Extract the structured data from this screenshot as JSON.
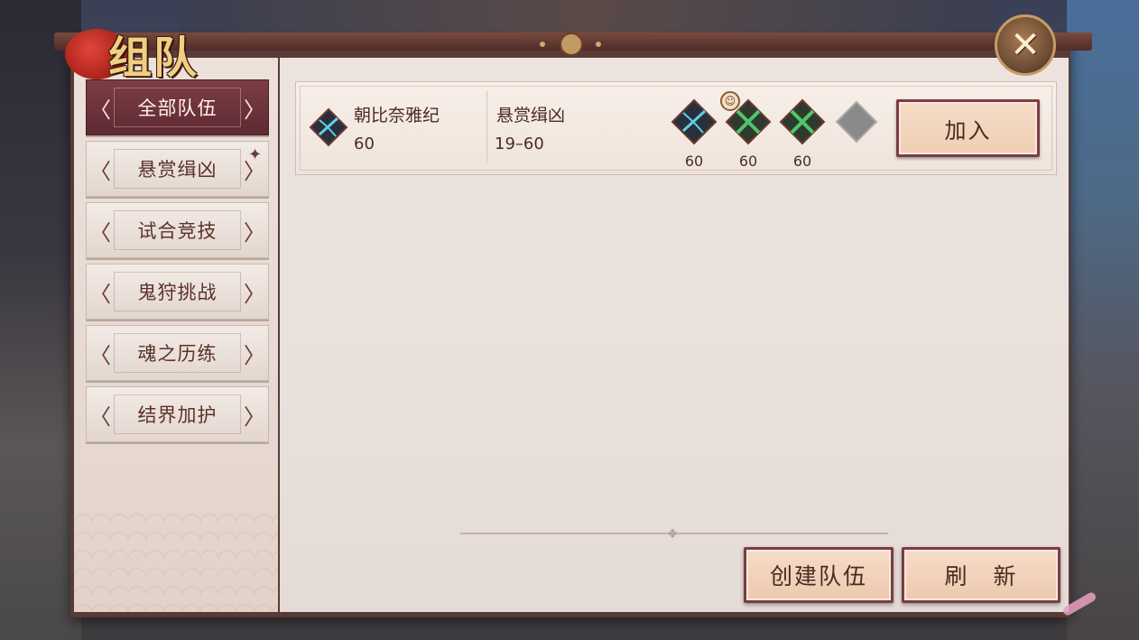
{
  "window": {
    "title": "组队",
    "close_label": "✕"
  },
  "sidebar": {
    "items": [
      {
        "label": "全部队伍",
        "active": true
      },
      {
        "label": "悬赏缉凶",
        "active": false
      },
      {
        "label": "试合竞技",
        "active": false
      },
      {
        "label": "鬼狩挑战",
        "active": false
      },
      {
        "label": "魂之历练",
        "active": false
      },
      {
        "label": "结界加护",
        "active": false
      }
    ],
    "arrow_left": "〈",
    "arrow_right": "〉"
  },
  "teams": [
    {
      "leader_name": "朝比奈雅纪",
      "leader_level": "60",
      "mode": "悬赏缉凶",
      "level_range": "19–60",
      "members": [
        {
          "level": "60",
          "icon": "blue-crossbow-icon",
          "captain": true
        },
        {
          "level": "60",
          "icon": "green-crossed-swords-icon",
          "captain": false
        },
        {
          "level": "60",
          "icon": "green-crossed-swords-icon",
          "captain": false
        },
        {
          "level": "",
          "icon": "empty-slot-icon",
          "captain": false
        }
      ],
      "join_label": "加入"
    }
  ],
  "footer": {
    "create_label": "创建队伍",
    "refresh_label": "刷　新"
  },
  "colors": {
    "accent": "#7b3d45",
    "active_tab": "#6b323b",
    "panel_bg": "#ede3de",
    "text": "#4a2c24"
  }
}
